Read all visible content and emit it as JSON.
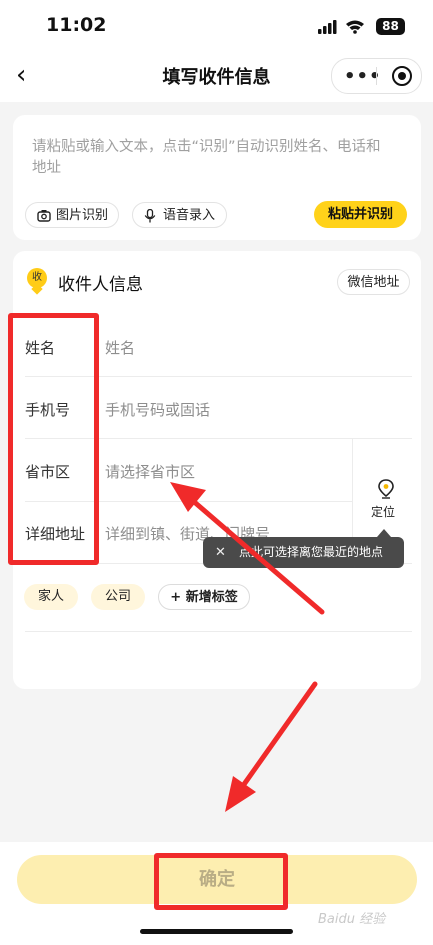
{
  "status_bar": {
    "time": "11:02",
    "battery": "88"
  },
  "nav": {
    "back_icon": "chevron-left-icon",
    "title": "填写收件信息",
    "more_icon": "more-dots-icon",
    "target_icon": "close-target-icon"
  },
  "paste_card": {
    "placeholder": "请粘贴或输入文本，点击“识别”自动识别姓名、电话和地址",
    "image_recognize": "图片识别",
    "voice_input": "语音录入",
    "paste_recognize": "粘贴并识别"
  },
  "recipient": {
    "badge": "收",
    "title": "收件人信息",
    "wechat_address": "微信地址",
    "fields": [
      {
        "label": "姓名",
        "placeholder": "姓名"
      },
      {
        "label": "手机号",
        "placeholder": "手机号码或固话"
      },
      {
        "label": "省市区",
        "placeholder": "请选择省市区"
      },
      {
        "label": "详细地址",
        "placeholder": "详细到镇、街道、门牌号"
      }
    ],
    "locate_label": "定位",
    "tooltip": "点此可选择离您最近的地点",
    "tags": [
      "家人",
      "公司",
      "+ 新增标签"
    ]
  },
  "confirm_button": "确定",
  "watermark": "Baidu 经验",
  "colors": {
    "accent_yellow": "#ffd21a",
    "annotation_red": "#f02a2a",
    "confirm_disabled": "#fdeeb0"
  }
}
